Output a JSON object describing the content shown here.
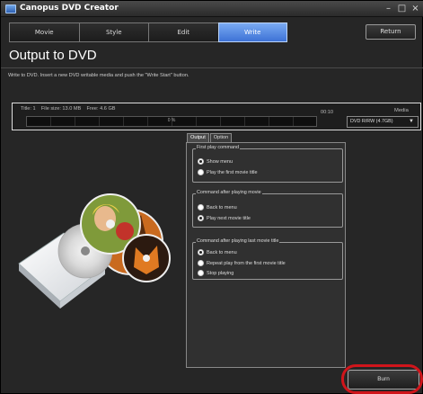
{
  "window": {
    "title": "Canopus DVD Creator",
    "controls": [
      "–",
      "□",
      "×"
    ]
  },
  "steps": [
    {
      "label": "Movie",
      "active": false
    },
    {
      "label": "Style",
      "active": false
    },
    {
      "label": "Edit",
      "active": false
    },
    {
      "label": "Write",
      "active": true
    }
  ],
  "return_label": "Return",
  "page_title": "Output to DVD",
  "instruction": "Write to DVD. Insert a new DVD writable media and push the \"Write Start\" button.",
  "info": {
    "title": "Title: 1",
    "file_size": "File size: 13.0 MB",
    "free": "Free: 4.6 GB",
    "duration": "00:10",
    "media_label": "Media",
    "media_value": "DVD R/RW (4.7GB)",
    "progress_text": "0 %",
    "progress": 0.0
  },
  "sub_tabs": [
    {
      "label": "Output",
      "active": true
    },
    {
      "label": "Option",
      "active": false
    }
  ],
  "groups": {
    "first_play": {
      "title": "First play command",
      "options": [
        {
          "label": "Show menu",
          "selected": true
        },
        {
          "label": "Play the first movie title",
          "selected": false
        }
      ]
    },
    "after_movie": {
      "title": "Command after playing movie",
      "options": [
        {
          "label": "Back to menu",
          "selected": false
        },
        {
          "label": "Play next movie title",
          "selected": true
        }
      ]
    },
    "after_last": {
      "title": "Command after playing last movie title",
      "options": [
        {
          "label": "Back to menu",
          "selected": true
        },
        {
          "label": "Repeat play from the first movie title",
          "selected": false
        },
        {
          "label": "Stop playing",
          "selected": false
        }
      ]
    }
  },
  "burn_label": "Burn",
  "colors": {
    "accent": "#4a82e0",
    "highlight_ring": "#d0151b",
    "background": "#262626"
  },
  "icons": {
    "app": "dvd-creator-icon",
    "dropdown": "chevron-down-icon"
  }
}
